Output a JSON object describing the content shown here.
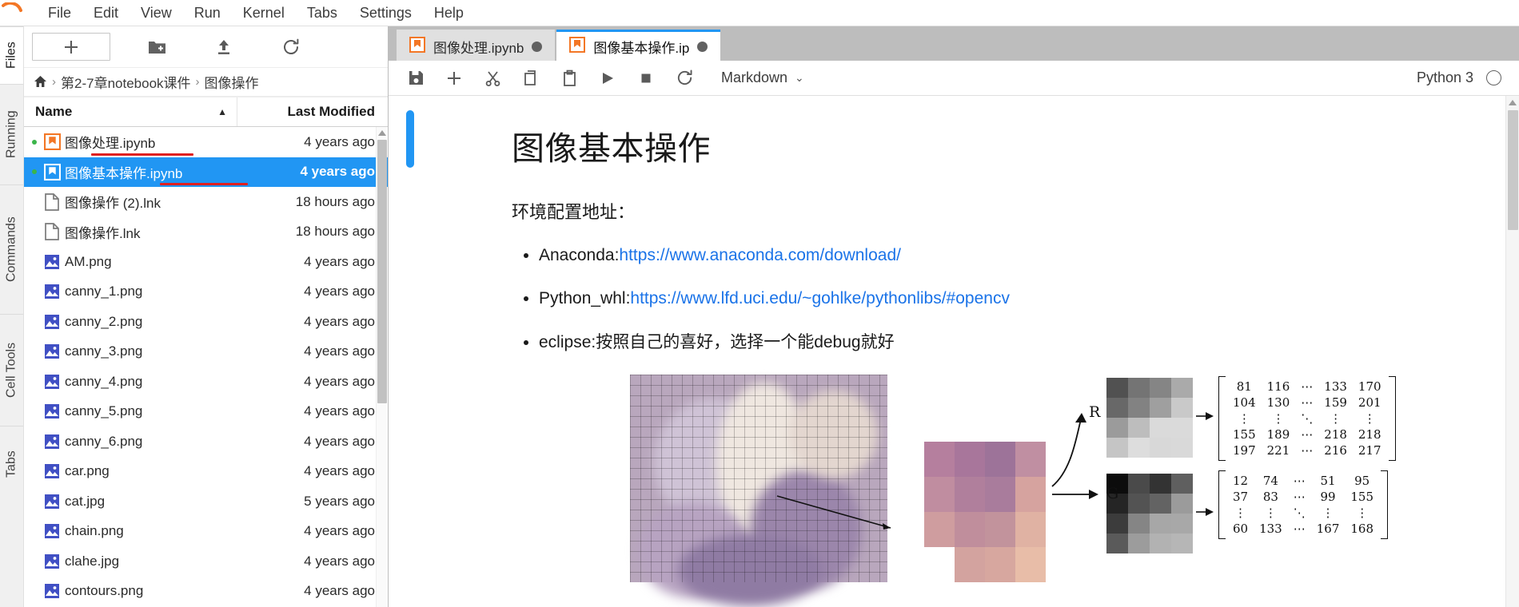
{
  "app": {
    "logo_name": "jupyter-logo",
    "accent_color": "#2196f3",
    "selection_color": "#2196f3",
    "annotation_color": "#e02020"
  },
  "menubar": {
    "items": [
      {
        "label": "File"
      },
      {
        "label": "Edit"
      },
      {
        "label": "View"
      },
      {
        "label": "Run"
      },
      {
        "label": "Kernel"
      },
      {
        "label": "Tabs"
      },
      {
        "label": "Settings"
      },
      {
        "label": "Help"
      }
    ]
  },
  "activitybar": {
    "items": [
      {
        "label": "Files",
        "active": true
      },
      {
        "label": "Running",
        "active": false
      },
      {
        "label": "Commands",
        "active": false
      },
      {
        "label": "Cell Tools",
        "active": false
      },
      {
        "label": "Tabs",
        "active": false
      }
    ]
  },
  "filebrowser": {
    "toolbar": {
      "new_launcher_label": "+",
      "new_folder_icon": "new-folder-icon",
      "upload_icon": "upload-icon",
      "refresh_icon": "refresh-icon"
    },
    "breadcrumb": {
      "home_icon": "home-icon",
      "separator": "›",
      "crumbs": [
        "第2-7章notebook课件",
        "图像操作"
      ]
    },
    "columns": {
      "name": "Name",
      "last_modified": "Last Modified",
      "sort_caret": "▲"
    },
    "rows": [
      {
        "name": "图像处理.ipynb",
        "modified": "4 years ago",
        "icon": "notebook-icon-running",
        "running": true,
        "selected": false,
        "annotated": true
      },
      {
        "name": "图像基本操作.ipynb",
        "modified": "4 years ago",
        "icon": "notebook-icon",
        "running": true,
        "selected": true,
        "annotated": true
      },
      {
        "name": "图像操作 (2).lnk",
        "modified": "18 hours ago",
        "icon": "file-icon",
        "running": false,
        "selected": false,
        "annotated": false
      },
      {
        "name": "图像操作.lnk",
        "modified": "18 hours ago",
        "icon": "file-icon",
        "running": false,
        "selected": false,
        "annotated": false
      },
      {
        "name": "AM.png",
        "modified": "4 years ago",
        "icon": "image-icon",
        "running": false,
        "selected": false,
        "annotated": false
      },
      {
        "name": "canny_1.png",
        "modified": "4 years ago",
        "icon": "image-icon",
        "running": false,
        "selected": false,
        "annotated": false
      },
      {
        "name": "canny_2.png",
        "modified": "4 years ago",
        "icon": "image-icon",
        "running": false,
        "selected": false,
        "annotated": false
      },
      {
        "name": "canny_3.png",
        "modified": "4 years ago",
        "icon": "image-icon",
        "running": false,
        "selected": false,
        "annotated": false
      },
      {
        "name": "canny_4.png",
        "modified": "4 years ago",
        "icon": "image-icon",
        "running": false,
        "selected": false,
        "annotated": false
      },
      {
        "name": "canny_5.png",
        "modified": "4 years ago",
        "icon": "image-icon",
        "running": false,
        "selected": false,
        "annotated": false
      },
      {
        "name": "canny_6.png",
        "modified": "4 years ago",
        "icon": "image-icon",
        "running": false,
        "selected": false,
        "annotated": false
      },
      {
        "name": "car.png",
        "modified": "4 years ago",
        "icon": "image-icon",
        "running": false,
        "selected": false,
        "annotated": false
      },
      {
        "name": "cat.jpg",
        "modified": "5 years ago",
        "icon": "image-icon",
        "running": false,
        "selected": false,
        "annotated": false
      },
      {
        "name": "chain.png",
        "modified": "4 years ago",
        "icon": "image-icon",
        "running": false,
        "selected": false,
        "annotated": false
      },
      {
        "name": "clahe.jpg",
        "modified": "4 years ago",
        "icon": "image-icon",
        "running": false,
        "selected": false,
        "annotated": false
      },
      {
        "name": "contours.png",
        "modified": "4 years ago",
        "icon": "image-icon",
        "running": false,
        "selected": false,
        "annotated": false
      }
    ]
  },
  "notebook": {
    "tabs": [
      {
        "label": "图像处理.ipynb",
        "icon": "notebook-icon-orange",
        "dirty": true,
        "active": false
      },
      {
        "label": "图像基本操作.ip",
        "icon": "notebook-icon-orange",
        "dirty": true,
        "active": true
      }
    ],
    "toolbar": {
      "save_icon": "save-icon",
      "insert_icon": "add-cell-icon",
      "cut_icon": "cut-icon",
      "copy_icon": "copy-icon",
      "paste_icon": "paste-icon",
      "run_icon": "run-icon",
      "stop_icon": "stop-icon",
      "restart_icon": "restart-icon",
      "cell_type": "Markdown",
      "cell_type_chevron": "⌄",
      "kernel_name": "Python 3",
      "kernel_status_icon": "kernel-idle-circle"
    },
    "cell": {
      "heading": "图像基本操作",
      "paragraph": "环境配置地址：",
      "bullets": [
        {
          "prefix": "Anaconda:",
          "link": "https://www.anaconda.com/download/"
        },
        {
          "prefix": "Python_whl:",
          "link": "https://www.lfd.uci.edu/~gohlke/pythonlibs/#opencv"
        },
        {
          "prefix": "eclipse:按照自己的喜好，选择一个能debug就好",
          "link": ""
        }
      ]
    },
    "figure": {
      "channel_labels": [
        "R",
        "G"
      ],
      "matrix_r": {
        "rows": [
          [
            "81",
            "116",
            "⋯",
            "133",
            "170"
          ],
          [
            "104",
            "130",
            "⋯",
            "159",
            "201"
          ],
          [
            "⋮",
            "⋮",
            "⋱",
            "⋮",
            "⋮"
          ],
          [
            "155",
            "189",
            "⋯",
            "218",
            "218"
          ],
          [
            "197",
            "221",
            "⋯",
            "216",
            "217"
          ]
        ]
      },
      "matrix_g": {
        "rows": [
          [
            "12",
            "74",
            "⋯",
            "51",
            "95"
          ],
          [
            "37",
            "83",
            "⋯",
            "99",
            "155"
          ],
          [
            "⋮",
            "⋮",
            "⋱",
            "⋮",
            "⋮"
          ],
          [
            "60",
            "133",
            "⋯",
            "167",
            "168"
          ]
        ]
      }
    }
  }
}
